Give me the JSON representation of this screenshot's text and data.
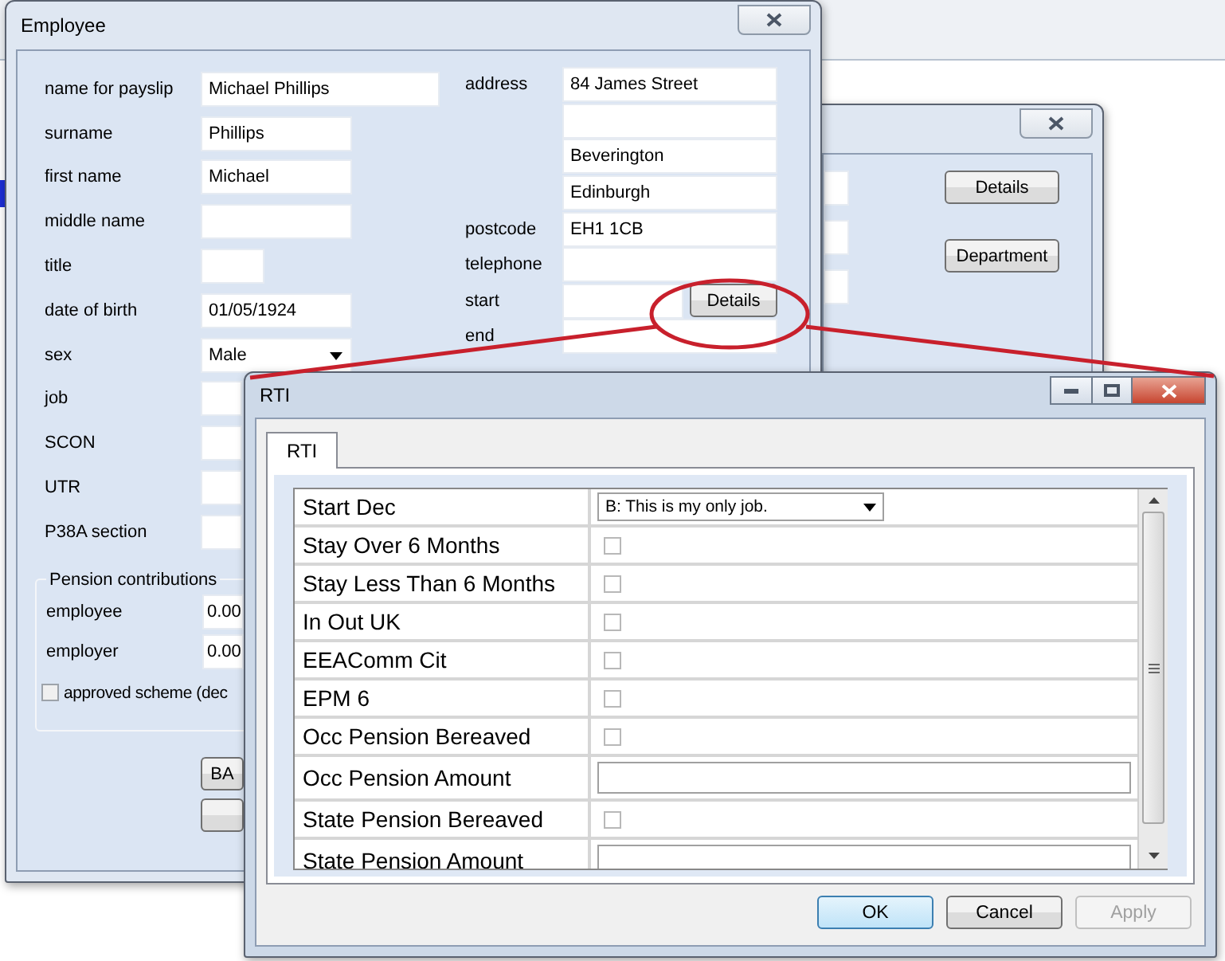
{
  "employee_window": {
    "title": "Employee",
    "left_fields": [
      {
        "label": "name for payslip",
        "kind": "wide",
        "value": "Michael Phillips"
      },
      {
        "label": "surname",
        "kind": "text",
        "value": "Phillips"
      },
      {
        "label": "first name",
        "kind": "text",
        "value": "Michael"
      },
      {
        "label": "middle name",
        "kind": "text"
      },
      {
        "label": "title",
        "kind": "short"
      },
      {
        "label": "date of birth",
        "kind": "text",
        "value": "01/05/1924"
      },
      {
        "label": "sex",
        "kind": "select",
        "value": "Male"
      },
      {
        "label": "job",
        "kind": "text"
      },
      {
        "label": "SCON",
        "kind": "text"
      },
      {
        "label": "UTR",
        "kind": "text"
      },
      {
        "label": "P38A section",
        "kind": "text"
      }
    ],
    "pension": {
      "legend": "Pension contributions",
      "fields": [
        {
          "label": "employee",
          "value": "0.00"
        },
        {
          "label": "employer",
          "value": "0.00"
        }
      ],
      "checkbox": {
        "label": "approved scheme (dec",
        "checked": false
      }
    },
    "buttons": [
      "BA"
    ],
    "address": {
      "label": "address",
      "lines": [
        {
          "kind": "filled",
          "value": "84 James Street"
        },
        {
          "kind": "blank"
        },
        {
          "kind": "filled",
          "value": "Beverington"
        },
        {
          "kind": "filled",
          "value": "Edinburgh"
        }
      ]
    },
    "right_fields": [
      {
        "label": "postcode",
        "value": "EH1 1CB"
      },
      {
        "label": "telephone"
      },
      {
        "label": "start",
        "button": "Details"
      },
      {
        "label": "end"
      }
    ]
  },
  "middle_window": {
    "buttons": [
      "Details",
      "Department"
    ]
  },
  "rti_window": {
    "title": "RTI",
    "tabs": [
      {
        "label": "RTI",
        "selected": true
      }
    ],
    "rows": [
      {
        "label": "Start Dec",
        "kind": "select",
        "value": "B: This is my only job."
      },
      {
        "label": "Stay Over 6 Months",
        "kind": "checkbox",
        "checked": false
      },
      {
        "label": "Stay Less Than 6 Months",
        "kind": "checkbox",
        "checked": false
      },
      {
        "label": "In Out UK",
        "kind": "checkbox",
        "checked": false
      },
      {
        "label": "EEAComm Cit",
        "kind": "checkbox",
        "checked": false
      },
      {
        "label": "EPM 6",
        "kind": "checkbox",
        "checked": false
      },
      {
        "label": "Occ Pension Bereaved",
        "kind": "checkbox",
        "checked": false
      },
      {
        "label": "Occ Pension Amount",
        "kind": "input"
      },
      {
        "label": "State Pension Bereaved",
        "kind": "checkbox",
        "checked": false
      },
      {
        "label": "State Pension Amount",
        "kind": "input"
      }
    ],
    "buttons": [
      {
        "label": "OK",
        "focused": true,
        "disabled": false
      },
      {
        "label": "Cancel",
        "focused": false,
        "disabled": false
      },
      {
        "label": "Apply",
        "focused": false,
        "disabled": true
      }
    ]
  }
}
